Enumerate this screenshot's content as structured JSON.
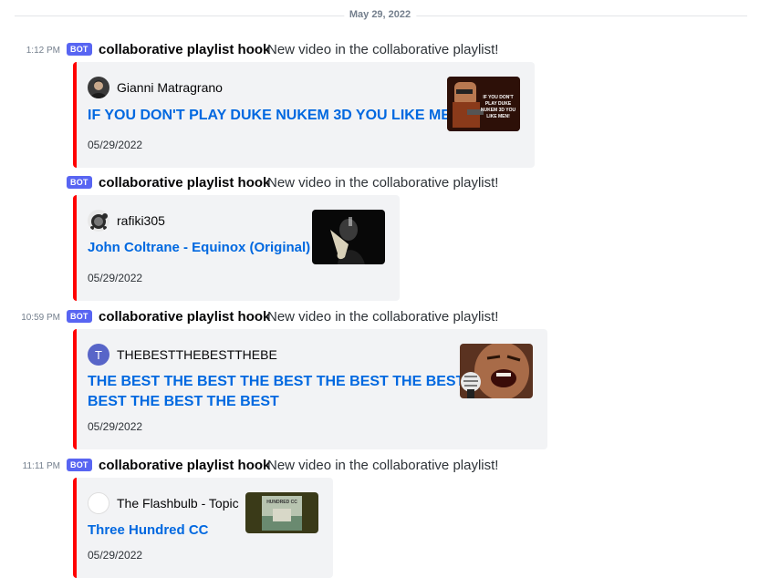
{
  "date_divider": "May 29, 2022",
  "bot_tag": "BOT",
  "messages": [
    {
      "timestamp": "1:12 PM",
      "author": "collaborative playlist hook",
      "content": "New video in the collaborative playlist!",
      "embed": {
        "author_name": "Gianni Matragrano",
        "title": "IF YOU DON'T PLAY DUKE NUKEM 3D YOU LIKE MEN!",
        "date": "05/29/2022",
        "thumb_text": "IF YOU DON'T PLAY DUKE NUKEM 3D YOU LIKE MEN!"
      }
    },
    {
      "timestamp": "",
      "author": "collaborative playlist hook",
      "content": "New video in the collaborative playlist!",
      "embed": {
        "author_name": "rafiki305",
        "title": "John Coltrane - Equinox (Original)",
        "date": "05/29/2022"
      }
    },
    {
      "timestamp": "10:59 PM",
      "author": "collaborative playlist hook",
      "content": "New video in the collaborative playlist!",
      "embed": {
        "author_initial": "T",
        "author_name": "THEBESTTHEBESTTHEBE",
        "title_line1": "THE BEST THE BEST THE BEST THE BEST THE BEST THE",
        "title_line2": "BEST THE BEST THE BEST",
        "date": "05/29/2022"
      }
    },
    {
      "timestamp": "11:11 PM",
      "author": "collaborative playlist hook",
      "content": "New video in the collaborative playlist!",
      "embed": {
        "author_name": "The Flashbulb - Topic",
        "title": "Three Hundred CC",
        "date": "05/29/2022",
        "thumb_text": "HUNDRED CC"
      }
    }
  ],
  "colors": {
    "embed_border": "#ff0000",
    "link": "#0068e0",
    "bot_tag": "#5865f2",
    "embed_bg": "#f2f3f5"
  }
}
